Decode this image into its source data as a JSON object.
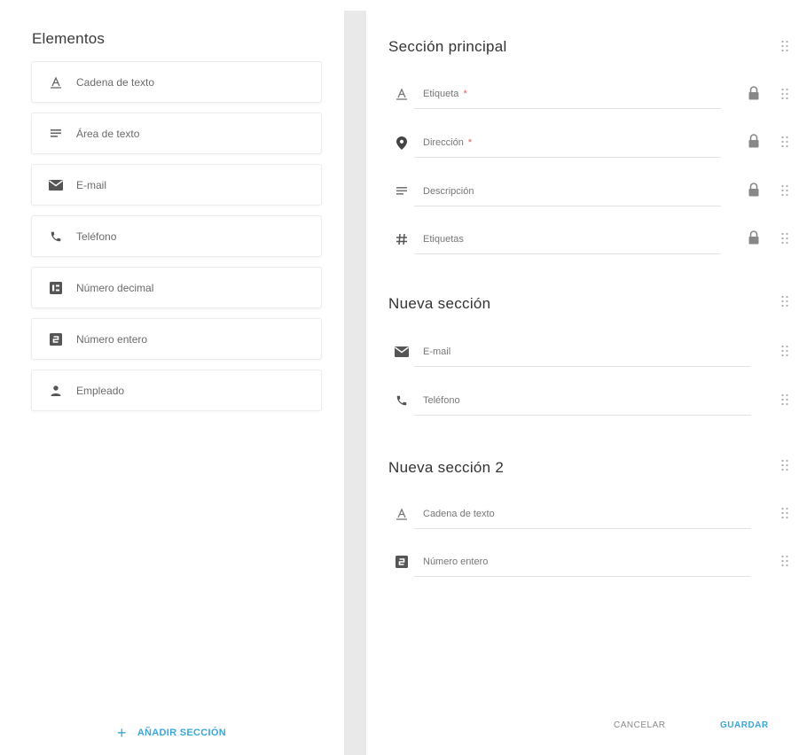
{
  "left_panel": {
    "title": "Elementos",
    "elements": [
      {
        "label": "Cadena de texto",
        "icon": "text-format-icon"
      },
      {
        "label": "Área de texto",
        "icon": "notes-icon"
      },
      {
        "label": "E-mail",
        "icon": "mail-icon"
      },
      {
        "label": "Teléfono",
        "icon": "phone-icon"
      },
      {
        "label": "Número decimal",
        "icon": "decimal-icon"
      },
      {
        "label": "Número entero",
        "icon": "integer-icon"
      },
      {
        "label": "Empleado",
        "icon": "person-icon"
      }
    ],
    "add_section_label": "AÑADIR SECCIÓN"
  },
  "sections": [
    {
      "title": "Sección principal",
      "fields": [
        {
          "label": "Etiqueta",
          "required": "*",
          "icon": "text-format-icon",
          "locked": true
        },
        {
          "label": "Dirección",
          "required": "*",
          "icon": "location-pin-icon",
          "locked": true
        },
        {
          "label": "Descripción",
          "required": "",
          "icon": "notes-icon",
          "locked": true
        },
        {
          "label": "Etiquetas",
          "required": "",
          "icon": "hashtag-icon",
          "locked": true
        }
      ]
    },
    {
      "title": "Nueva sección",
      "fields": [
        {
          "label": "E-mail",
          "required": "",
          "icon": "mail-icon",
          "locked": false
        },
        {
          "label": "Teléfono",
          "required": "",
          "icon": "phone-icon",
          "locked": false
        }
      ]
    },
    {
      "title": "Nueva sección 2",
      "fields": [
        {
          "label": "Cadena de texto",
          "required": "",
          "icon": "text-format-icon",
          "locked": false
        },
        {
          "label": "Número entero",
          "required": "",
          "icon": "integer-icon",
          "locked": false
        }
      ]
    }
  ],
  "actions": {
    "cancel_label": "CANCELAR",
    "save_label": "GUARDAR"
  },
  "colors": {
    "accent": "#3aa7d8",
    "icon": "#666666",
    "required": "#e05a5a",
    "divider": "#e9e9e9"
  }
}
